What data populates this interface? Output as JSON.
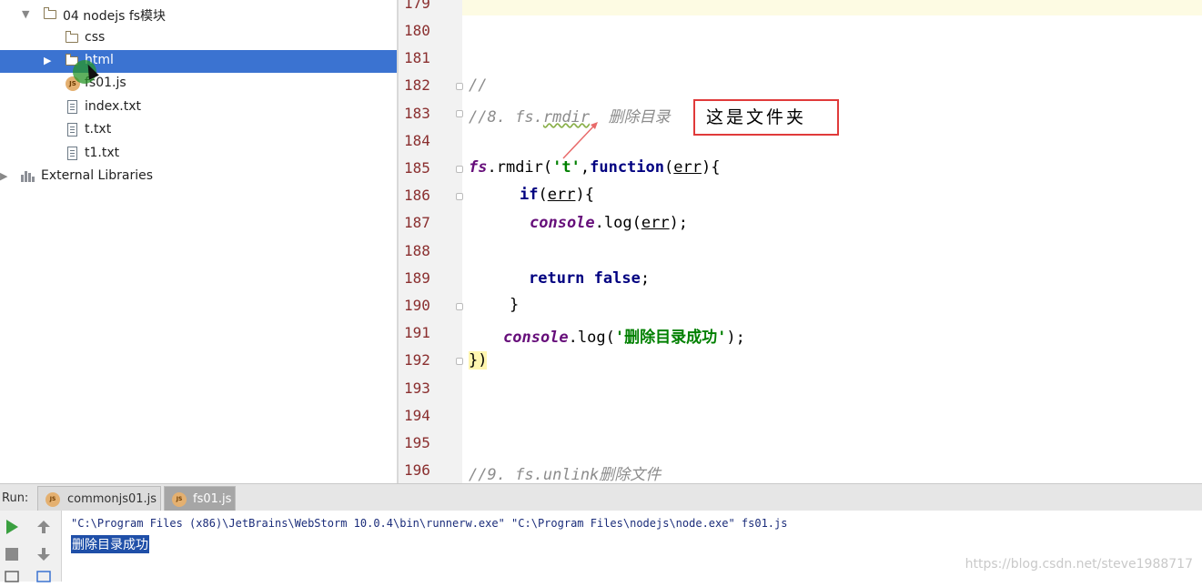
{
  "project_tree": {
    "items": [
      {
        "label": "04 nodejs fs模块",
        "type": "folder",
        "expanded": true
      },
      {
        "label": "css",
        "type": "folder"
      },
      {
        "label": "html",
        "type": "folder",
        "selected": true
      },
      {
        "label": "fs01.js",
        "type": "js"
      },
      {
        "label": "index.txt",
        "type": "txt"
      },
      {
        "label": "t.txt",
        "type": "txt"
      },
      {
        "label": "t1.txt",
        "type": "txt"
      },
      {
        "label": "External Libraries",
        "type": "library"
      }
    ]
  },
  "editor": {
    "line_numbers": [
      "179",
      "180",
      "181",
      "182",
      "183",
      "184",
      "185",
      "186",
      "187",
      "188",
      "189",
      "190",
      "191",
      "192",
      "193",
      "194",
      "195",
      "196"
    ],
    "code": {
      "l182": "//",
      "l183_a": "//8. fs.",
      "l183_b": "rmdir",
      "l183_c": "  删除目录",
      "l185_obj": "fs",
      "l185_dot": ".rmdir(",
      "l185_str": "'t'",
      "l185_comma": ",",
      "l185_kw": "function",
      "l185_paren": "(",
      "l185_param": "err",
      "l185_end": "){",
      "l186_kw": "if",
      "l186_paren": "(",
      "l186_param": "err",
      "l186_end": "){",
      "l187_obj": "console",
      "l187_mid": ".log(",
      "l187_param": "err",
      "l187_end": ");",
      "l189_kw1": "return",
      "l189_kw2": "false",
      "l189_end": ";",
      "l190": "}",
      "l191_obj": "console",
      "l191_mid": ".log(",
      "l191_str": "'删除目录成功'",
      "l191_end": ");",
      "l192": "})",
      "l196": "//9. fs.unlink删除文件"
    },
    "annotation": "这是文件夹"
  },
  "run_panel": {
    "label": "Run:",
    "tabs": [
      {
        "label": "commonjs01.js",
        "active": false
      },
      {
        "label": "fs01.js",
        "active": true
      }
    ],
    "command_line": "\"C:\\Program Files (x86)\\JetBrains\\WebStorm 10.0.4\\bin\\runnerw.exe\" \"C:\\Program Files\\nodejs\\node.exe\" fs01.js",
    "output": "删除目录成功"
  },
  "watermark": "https://blog.csdn.net/steve1988717",
  "colors": {
    "selection": "#3b73d1",
    "line_number": "#8a2f2f",
    "keyword": "#000080",
    "string": "#008000",
    "object": "#660e7a",
    "comment": "#8c8c8c",
    "note_border": "#e03a3a"
  }
}
